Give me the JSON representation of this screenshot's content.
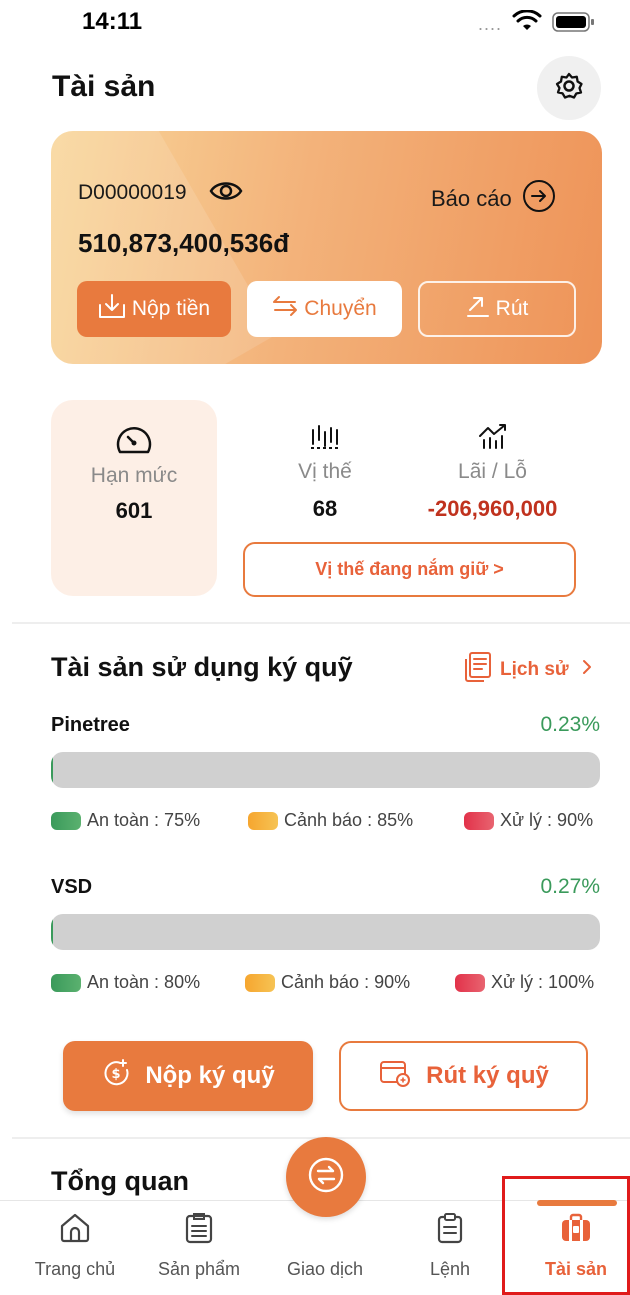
{
  "status_bar": {
    "time": "14:11"
  },
  "header": {
    "title": "Tài sản"
  },
  "account": {
    "id": "D00000019",
    "report_label": "Báo cáo",
    "balance": "510,873,400,536đ",
    "deposit_label": "Nộp tiền",
    "transfer_label": "Chuyển",
    "withdraw_label": "Rút"
  },
  "stats": {
    "limit": {
      "label": "Hạn mức",
      "value": "601"
    },
    "position": {
      "label": "Vị thế",
      "value": "68"
    },
    "pnl": {
      "label": "Lãi / Lỗ",
      "value": "-206,960,000"
    },
    "holding_button": "Vị thế đang nắm giữ >"
  },
  "margin": {
    "title": "Tài sản sử dụng ký quỹ",
    "history_label": "Lịch sử",
    "accounts": [
      {
        "name": "Pinetree",
        "percent": "0.23%",
        "fill_fraction": 0.0023,
        "safe_label": "An toàn : 75%",
        "warning_label": "Cảnh báo : 85%",
        "risk_label": "Xử lý : 90%"
      },
      {
        "name": "VSD",
        "percent": "0.27%",
        "fill_fraction": 0.0027,
        "safe_label": "An toàn : 80%",
        "warning_label": "Cảnh báo : 90%",
        "risk_label": "Xử lý : 100%"
      }
    ],
    "deposit_button": "Nộp ký quỹ",
    "withdraw_button": "Rút ký quỹ"
  },
  "overview": {
    "title": "Tổng quan"
  },
  "tabs": [
    {
      "label": "Trang chủ",
      "icon": "home-icon"
    },
    {
      "label": "Sản phẩm",
      "icon": "product-icon"
    },
    {
      "label": "Giao dịch",
      "icon": "exchange-icon"
    },
    {
      "label": "Lệnh",
      "icon": "order-icon"
    },
    {
      "label": "Tài sản",
      "icon": "briefcase-icon",
      "active": true
    }
  ],
  "colors": {
    "accent": "#e87a3e",
    "loss": "#c0321e",
    "safe": "#3a9a5b",
    "warning": "#f6a62f",
    "risk": "#e2324a"
  }
}
